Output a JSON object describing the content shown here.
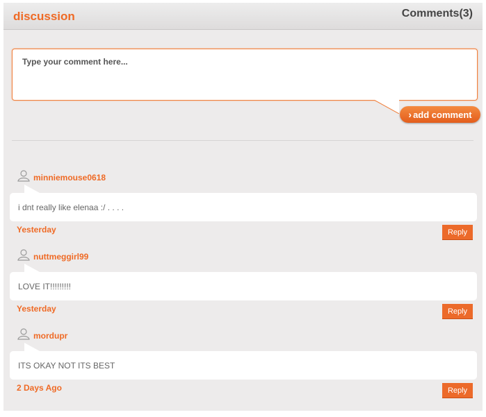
{
  "header": {
    "title": "discussion",
    "comments_count": "Comments(3)"
  },
  "composer": {
    "placeholder": "Type your comment here...",
    "add_button_label": "add comment"
  },
  "icons": {
    "add_button": "chevron-right-icon",
    "avatar": "user-icon"
  },
  "colors": {
    "accent": "#ef6a25",
    "panel_bg": "#edebeb",
    "reply_bg": "#ec6a2a"
  },
  "comments": [
    {
      "username": "minniemouse0618",
      "text": "i dnt really like elenaa :/ . . . .",
      "time": "Yesterday",
      "reply_label": "Reply"
    },
    {
      "username": "nuttmeggirl99",
      "text": "LOVE IT!!!!!!!!!",
      "time": "Yesterday",
      "reply_label": "Reply"
    },
    {
      "username": "mordupr",
      "text": "ITS OKAY NOT ITS BEST",
      "time": "2 Days Ago",
      "reply_label": "Reply"
    }
  ]
}
